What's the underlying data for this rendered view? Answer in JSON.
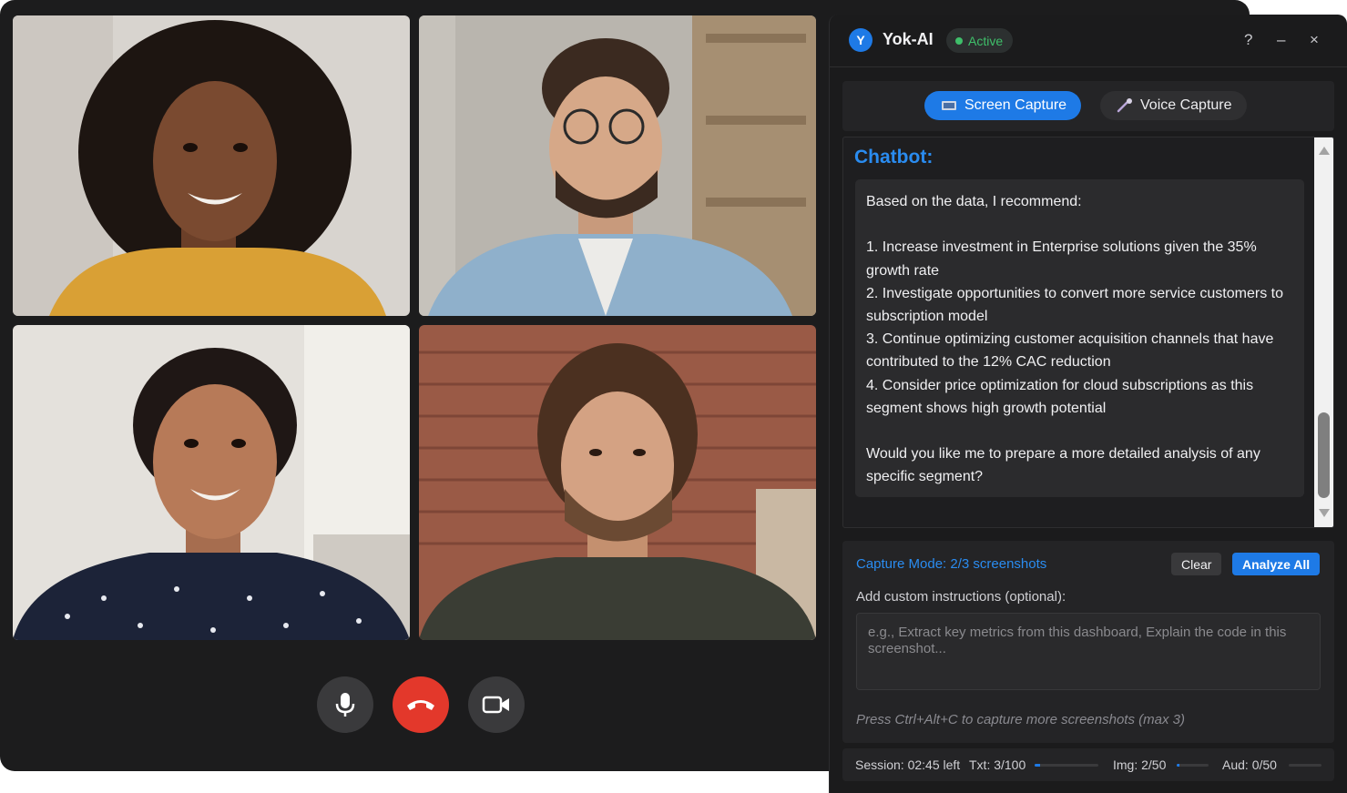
{
  "call": {
    "controls": [
      {
        "name": "mic-button",
        "icon": "microphone-icon"
      },
      {
        "name": "end-call-button",
        "icon": "phone-hangup-icon"
      },
      {
        "name": "camera-button",
        "icon": "video-camera-icon"
      }
    ]
  },
  "app": {
    "logo_letter": "Y",
    "name": "Yok-AI",
    "status": "Active",
    "status_color": "#3fbf6a",
    "accent_color": "#1e7ae6",
    "window_buttons": {
      "help": "?",
      "minimize": "–",
      "close": "×"
    }
  },
  "modes": {
    "screen_capture": "Screen Capture",
    "voice_capture": "Voice Capture",
    "active": "Screen Capture"
  },
  "chat": {
    "label": "Chatbot:",
    "message": "Based on the data, I recommend:\n\n1. Increase investment in Enterprise solutions given the 35% growth rate\n2. Investigate opportunities to convert more service customers to subscription model\n3. Continue optimizing customer acquisition channels that have contributed to the 12% CAC reduction\n4. Consider price optimization for cloud subscriptions as this segment shows high growth potential\n\nWould you like me to prepare a more detailed analysis of any specific segment?"
  },
  "capture": {
    "mode_text": "Capture Mode: 2/3 screenshots",
    "clear_label": "Clear",
    "analyze_label": "Analyze All",
    "instructions_label": "Add custom instructions (optional):",
    "instructions_value": "",
    "instructions_placeholder": "e.g., Extract key metrics from this dashboard, Explain the code in this screenshot...",
    "hint": "Press Ctrl+Alt+C to capture more screenshots (max 3)"
  },
  "status_bar": {
    "session": "Session: 02:45 left",
    "txt": "Txt: 3/100",
    "txt_fraction": 0.03,
    "img": "Img: 2/50",
    "img_fraction": 0.04,
    "aud": "Aud: 0/50",
    "aud_fraction": 0.0
  }
}
